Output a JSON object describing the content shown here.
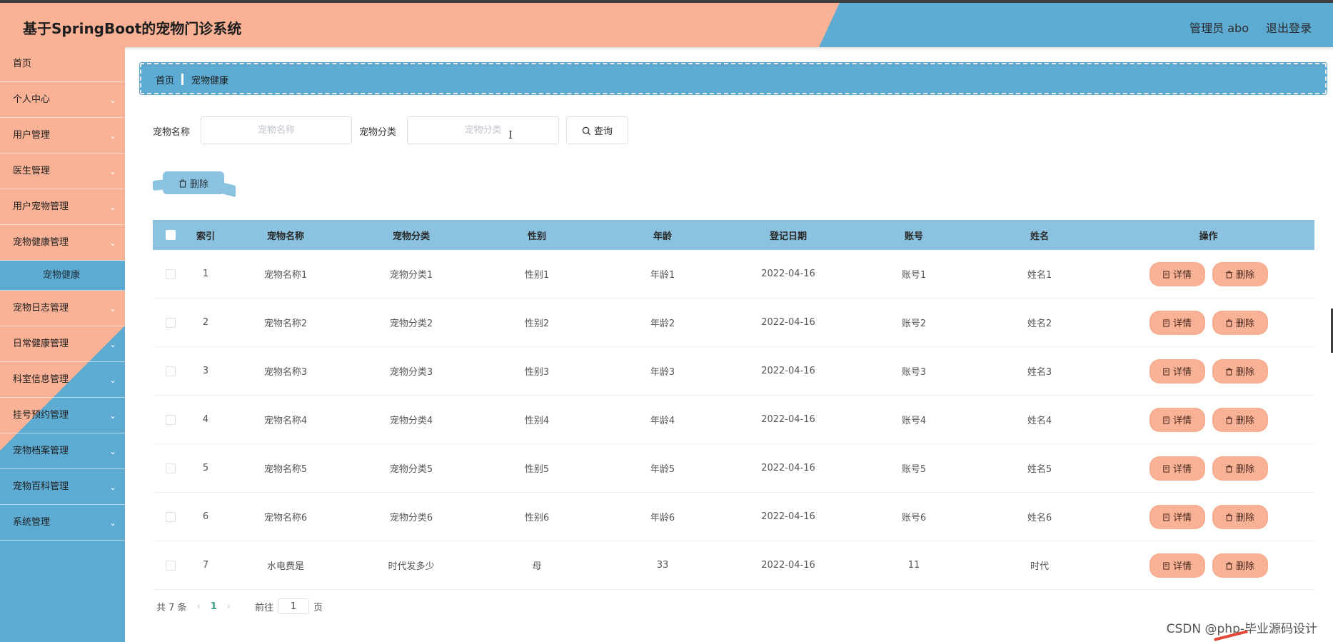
{
  "header": {
    "title": "基于SpringBoot的宠物门诊系统",
    "user": "管理员 abo",
    "logout": "退出登录"
  },
  "sidebar": {
    "items": [
      {
        "label": "首页"
      },
      {
        "label": "个人中心"
      },
      {
        "label": "用户管理"
      },
      {
        "label": "医生管理"
      },
      {
        "label": "用户宠物管理"
      },
      {
        "label": "宠物健康管理"
      },
      {
        "label": "宠物健康"
      },
      {
        "label": "宠物日志管理"
      },
      {
        "label": "日常健康管理"
      },
      {
        "label": "科室信息管理"
      },
      {
        "label": "挂号预约管理"
      },
      {
        "label": "宠物档案管理"
      },
      {
        "label": "宠物百科管理"
      },
      {
        "label": "系统管理"
      }
    ],
    "chevron": "⌄"
  },
  "breadcrumb": {
    "home": "首页",
    "current": "宠物健康"
  },
  "search": {
    "name_label": "宠物名称",
    "name_placeholder": "宠物名称",
    "category_label": "宠物分类",
    "category_placeholder": "宠物分类",
    "button": "查询",
    "cursor": "I"
  },
  "batch_delete": "删除",
  "table": {
    "headers": [
      "索引",
      "宠物名称",
      "宠物分类",
      "性别",
      "年龄",
      "登记日期",
      "账号",
      "姓名",
      "操作"
    ],
    "rows": [
      [
        "1",
        "宠物名称1",
        "宠物分类1",
        "性别1",
        "年龄1",
        "2022-04-16",
        "账号1",
        "姓名1"
      ],
      [
        "2",
        "宠物名称2",
        "宠物分类2",
        "性别2",
        "年龄2",
        "2022-04-16",
        "账号2",
        "姓名2"
      ],
      [
        "3",
        "宠物名称3",
        "宠物分类3",
        "性别3",
        "年龄3",
        "2022-04-16",
        "账号3",
        "姓名3"
      ],
      [
        "4",
        "宠物名称4",
        "宠物分类4",
        "性别4",
        "年龄4",
        "2022-04-16",
        "账号4",
        "姓名4"
      ],
      [
        "5",
        "宠物名称5",
        "宠物分类5",
        "性别5",
        "年龄5",
        "2022-04-16",
        "账号5",
        "姓名5"
      ],
      [
        "6",
        "宠物名称6",
        "宠物分类6",
        "性别6",
        "年龄6",
        "2022-04-16",
        "账号6",
        "姓名6"
      ],
      [
        "7",
        "水电费是",
        "时代发多少",
        "母",
        "33",
        "2022-04-16",
        "11",
        "时代"
      ]
    ],
    "detail_label": "详情",
    "delete_label": "删除"
  },
  "pager": {
    "total": "共 7 条",
    "prev": "‹",
    "current": "1",
    "next": "›",
    "goto_prefix": "前往",
    "goto_value": "1",
    "goto_suffix": "页"
  },
  "watermark": "CSDN @php-毕业源码设计",
  "colors": {
    "salmon": "#f9b296",
    "blue": "#5dabd3",
    "light_blue": "#8bc2df"
  }
}
